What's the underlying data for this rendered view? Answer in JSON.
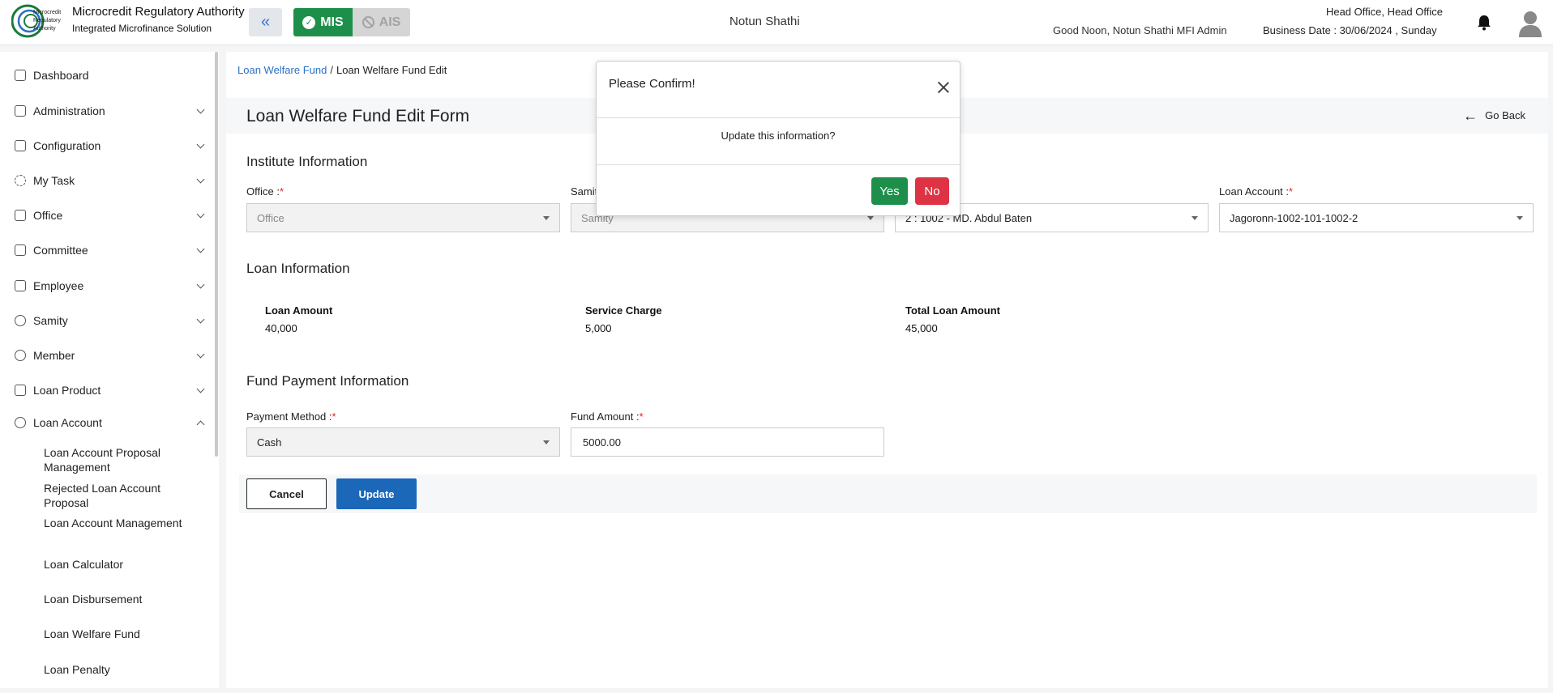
{
  "header": {
    "org_name": "Microcredit Regulatory Authority",
    "org_sub": "Integrated Microfinance Solution",
    "logo_text_1": "Microcredit",
    "logo_text_2": "Regulatory",
    "logo_text_3": "Authority",
    "mode_mis": "MIS",
    "mode_ais": "AIS",
    "center_title": "Notun Shathi",
    "greeting": "Good Noon, Notun Shathi MFI Admin",
    "office": "Head Office, Head Office",
    "business_date": "Business Date : 30/06/2024 , Sunday"
  },
  "sidebar": {
    "items": [
      {
        "label": "Dashboard"
      },
      {
        "label": "Administration"
      },
      {
        "label": "Configuration"
      },
      {
        "label": "My Task"
      },
      {
        "label": "Office"
      },
      {
        "label": "Committee"
      },
      {
        "label": "Employee"
      },
      {
        "label": "Samity"
      },
      {
        "label": "Member"
      },
      {
        "label": "Loan Product"
      },
      {
        "label": "Loan Account"
      }
    ],
    "sub_items": [
      {
        "label": "Loan Account Proposal Management"
      },
      {
        "label": "Rejected Loan Account Proposal"
      },
      {
        "label": "Loan Account Management"
      },
      {
        "label": "Loan Calculator"
      },
      {
        "label": "Loan Disbursement"
      },
      {
        "label": "Loan Welfare Fund"
      },
      {
        "label": "Loan Penalty"
      }
    ]
  },
  "breadcrumb": {
    "link": "Loan Welfare Fund",
    "sep": "/",
    "current": "Loan Welfare Fund Edit"
  },
  "page": {
    "title": "Loan Welfare Fund Edit Form",
    "go_back": "Go Back"
  },
  "institute": {
    "title": "Institute Information",
    "office_label": "Office :",
    "office_placeholder": "Office",
    "samity_label": "Samit",
    "samity_placeholder": "Samity",
    "member_value": "2 : 1002 - MD. Abdul Baten",
    "loan_account_label": "Loan Account :",
    "loan_account_value": "Jagoronn-1002-101-1002-2",
    "req": "*"
  },
  "loan_info": {
    "title": "Loan Information",
    "loan_amount_label": "Loan Amount",
    "loan_amount_value": "40,000",
    "service_charge_label": "Service Charge",
    "service_charge_value": "5,000",
    "total_label": "Total Loan Amount",
    "total_value": "45,000"
  },
  "fund_payment": {
    "title": "Fund Payment Information",
    "method_label": "Payment Method :",
    "method_value": "Cash",
    "amount_label": "Fund Amount :",
    "amount_value": "5000.00"
  },
  "actions": {
    "cancel": "Cancel",
    "update": "Update"
  },
  "modal": {
    "title": "Please Confirm!",
    "body": "Update this information?",
    "yes": "Yes",
    "no": "No"
  }
}
